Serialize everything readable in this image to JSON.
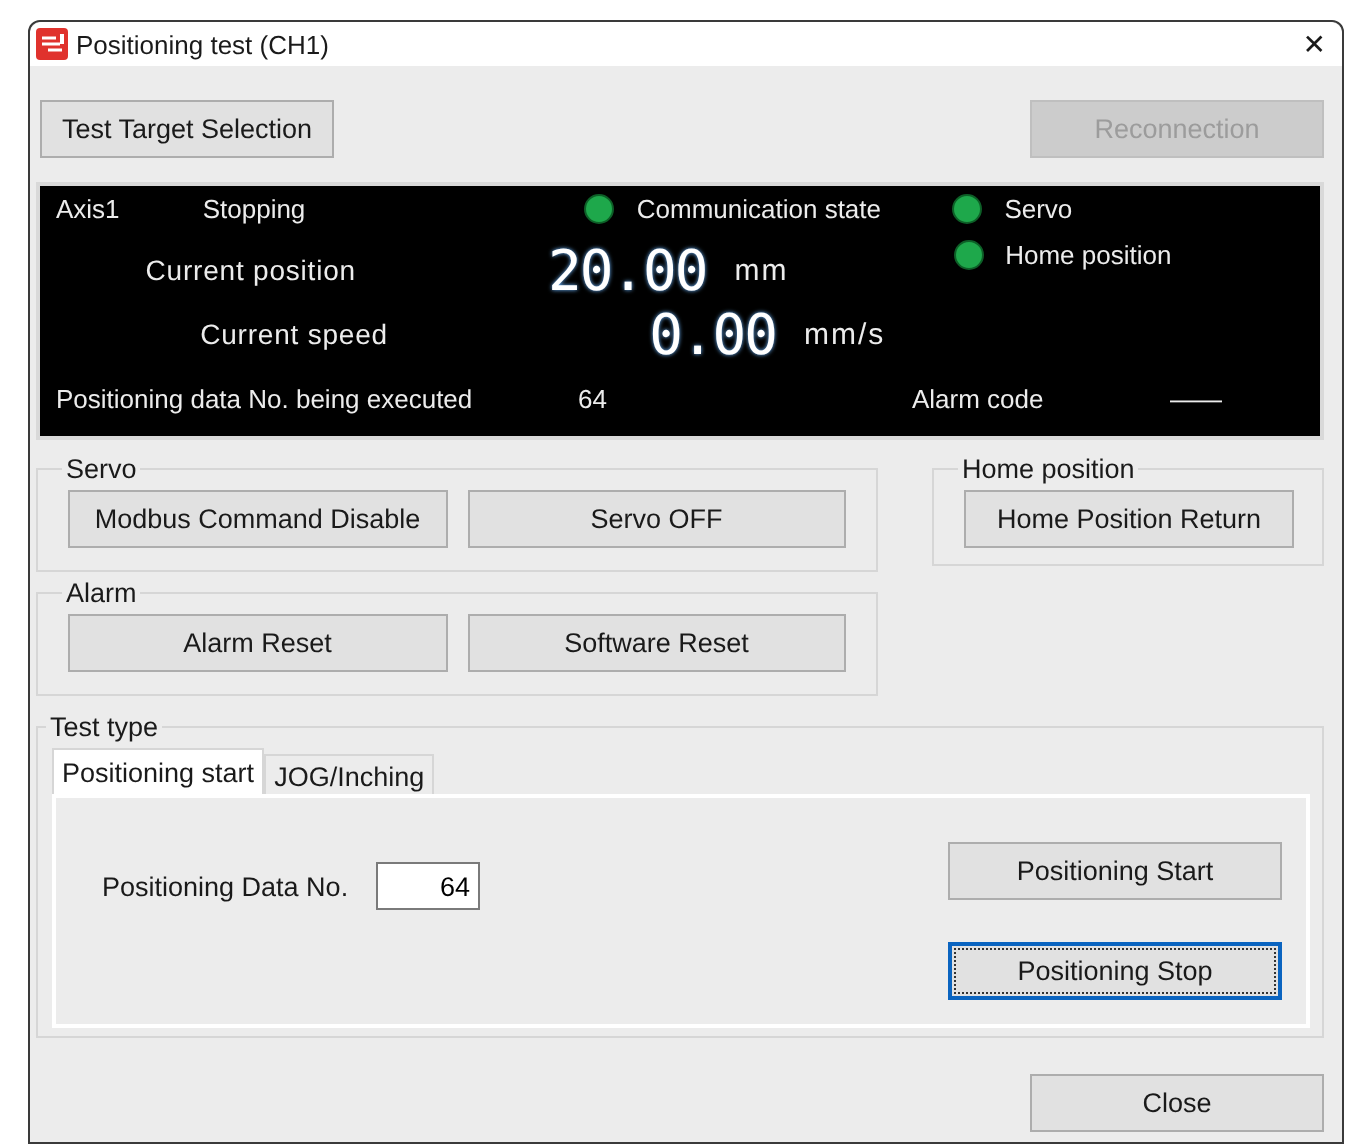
{
  "window": {
    "title": "Positioning test (CH1)",
    "close_glyph": "✕"
  },
  "toolbar": [
    {
      "label": "Test Target Selection",
      "disabled": false
    },
    {
      "label": "Reconnection",
      "disabled": true
    }
  ],
  "monitor": {
    "axis": "Axis1",
    "operation_state": "Stopping",
    "indicators": [
      {
        "label": "Communication state",
        "on": true
      },
      {
        "label": "Servo",
        "on": true
      },
      {
        "label": "Home position",
        "on": true
      }
    ],
    "readings": [
      {
        "label": "Current position",
        "value": "20.00",
        "unit": "mm"
      },
      {
        "label": "Current speed",
        "value": "0.00",
        "unit": "mm/s"
      }
    ],
    "executing": {
      "label": "Positioning data No. being executed",
      "value": "64"
    },
    "alarm": {
      "label": "Alarm code",
      "value": "——"
    }
  },
  "servo": {
    "title": "Servo",
    "buttons": [
      {
        "label": "Modbus Command Disable"
      },
      {
        "label": "Servo OFF"
      }
    ]
  },
  "home_position": {
    "title": "Home position",
    "buttons": [
      {
        "label": "Home Position Return"
      }
    ]
  },
  "alarm": {
    "title": "Alarm",
    "buttons": [
      {
        "label": "Alarm Reset"
      },
      {
        "label": "Software Reset"
      }
    ]
  },
  "test_type": {
    "title": "Test type",
    "tabs": [
      {
        "label": "Positioning start",
        "selected": true
      },
      {
        "label": "JOG/Inching",
        "selected": false
      }
    ],
    "data_no": {
      "label": "Positioning Data No.",
      "value": "64"
    },
    "buttons": [
      {
        "label": "Positioning Start",
        "focused": false
      },
      {
        "label": "Positioning Stop",
        "focused": true
      }
    ]
  },
  "footer": {
    "buttons": [
      {
        "label": "Close"
      }
    ]
  }
}
